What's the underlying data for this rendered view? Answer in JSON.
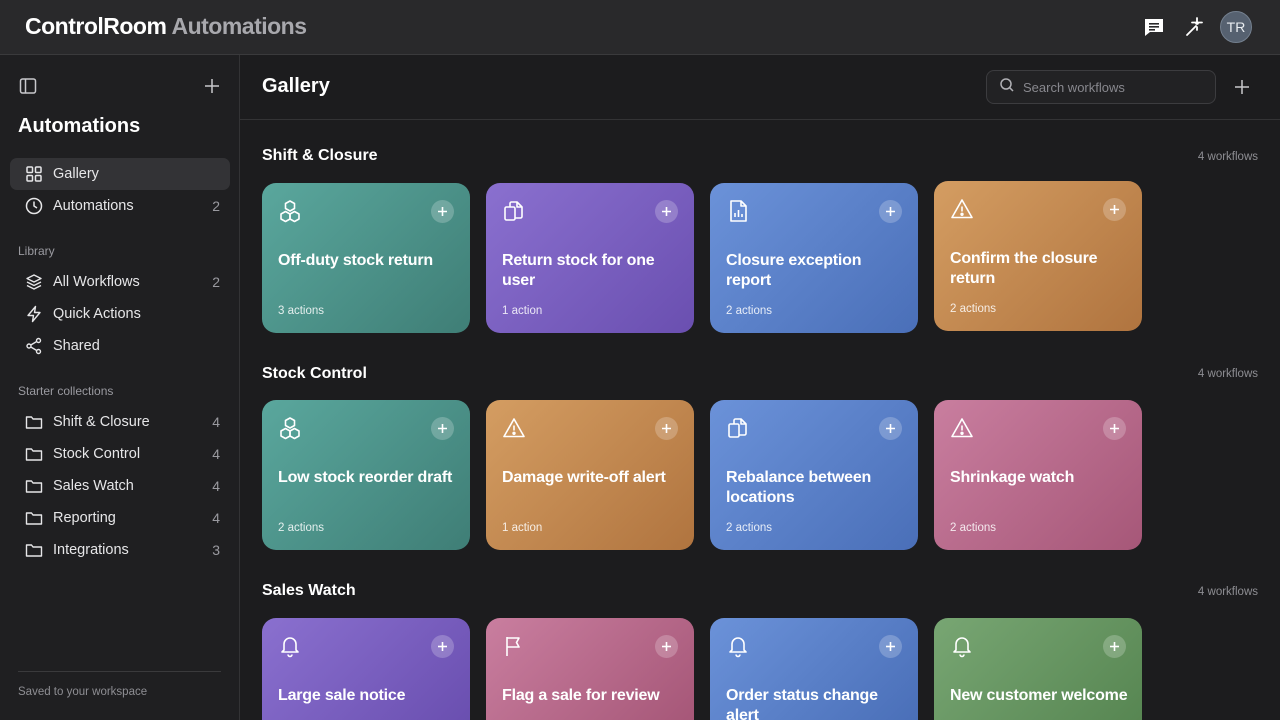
{
  "app": {
    "brand_primary": "ControlRoom",
    "brand_secondary": "Automations",
    "avatar_initials": "TR"
  },
  "sidebar": {
    "title": "Automations",
    "nav": [
      {
        "label": "Gallery",
        "icon": "grid-icon",
        "count": "",
        "active": true
      },
      {
        "label": "Automations",
        "icon": "clock-icon",
        "count": "2"
      }
    ],
    "library_heading": "Library",
    "library": [
      {
        "label": "All Workflows",
        "icon": "layers-icon",
        "count": "2"
      },
      {
        "label": "Quick Actions",
        "icon": "bolt-icon",
        "count": ""
      },
      {
        "label": "Shared",
        "icon": "share-icon",
        "count": ""
      }
    ],
    "collections_heading": "Starter collections",
    "collections": [
      {
        "label": "Shift & Closure",
        "icon": "folder-icon",
        "count": "4"
      },
      {
        "label": "Stock Control",
        "icon": "folder-icon",
        "count": "4"
      },
      {
        "label": "Sales Watch",
        "icon": "folder-icon",
        "count": "4"
      },
      {
        "label": "Reporting",
        "icon": "folder-icon",
        "count": "4"
      },
      {
        "label": "Integrations",
        "icon": "folder-icon",
        "count": "3"
      }
    ],
    "footer": "Saved to your workspace"
  },
  "main": {
    "title": "Gallery",
    "search_placeholder": "Search workflows",
    "sections": [
      {
        "title": "Shift & Closure",
        "count": "4 workflows",
        "cards": [
          {
            "title": "Off-duty stock return",
            "actions": "3 actions",
            "color": "teal",
            "icon": "cubes-icon"
          },
          {
            "title": "Return stock for one user",
            "actions": "1 action",
            "color": "purple",
            "icon": "copy-icon"
          },
          {
            "title": "Closure exception report",
            "actions": "2 actions",
            "color": "blue",
            "icon": "report-icon"
          },
          {
            "title": "Confirm the closure return",
            "actions": "2 actions",
            "color": "orange",
            "icon": "warning-icon"
          }
        ]
      },
      {
        "title": "Stock Control",
        "count": "4 workflows",
        "cards": [
          {
            "title": "Low stock reorder draft",
            "actions": "2 actions",
            "color": "teal",
            "icon": "cubes-icon"
          },
          {
            "title": "Damage write-off alert",
            "actions": "1 action",
            "color": "orange",
            "icon": "warning-icon"
          },
          {
            "title": "Rebalance between locations",
            "actions": "2 actions",
            "color": "blue",
            "icon": "copy-icon"
          },
          {
            "title": "Shrinkage watch",
            "actions": "2 actions",
            "color": "pink",
            "icon": "warning-icon"
          }
        ]
      },
      {
        "title": "Sales Watch",
        "count": "4 workflows",
        "cards": [
          {
            "title": "Large sale notice",
            "actions": "",
            "color": "purple",
            "icon": "bell-icon"
          },
          {
            "title": "Flag a sale for review",
            "actions": "",
            "color": "pink",
            "icon": "flag-icon"
          },
          {
            "title": "Order status change alert",
            "actions": "",
            "color": "blue",
            "icon": "bell-icon"
          },
          {
            "title": "New customer welcome",
            "actions": "",
            "color": "green",
            "icon": "bell-icon"
          }
        ]
      }
    ]
  },
  "colors": {
    "teal": "#4f958c",
    "purple": "#7a5fc0",
    "blue": "#5b80c8",
    "orange": "#c28850",
    "pink": "#b86a8c",
    "green": "#679662"
  }
}
